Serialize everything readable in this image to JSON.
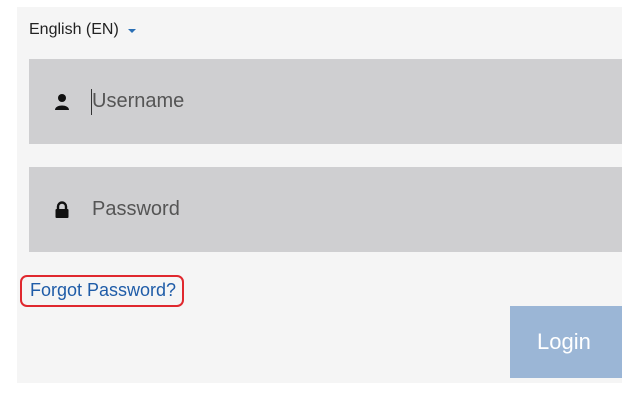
{
  "language": {
    "selected": "English (EN)",
    "icon": "chevron-down-icon"
  },
  "username": {
    "placeholder": "Username",
    "icon": "user-icon"
  },
  "password": {
    "placeholder": "Password",
    "icon": "lock-icon"
  },
  "forgot_password": {
    "label": "Forgot Password?",
    "highlight_color": "#e0282e",
    "link_color": "#1f5ca8"
  },
  "login": {
    "label": "Login",
    "color": "#9bb6d6"
  }
}
